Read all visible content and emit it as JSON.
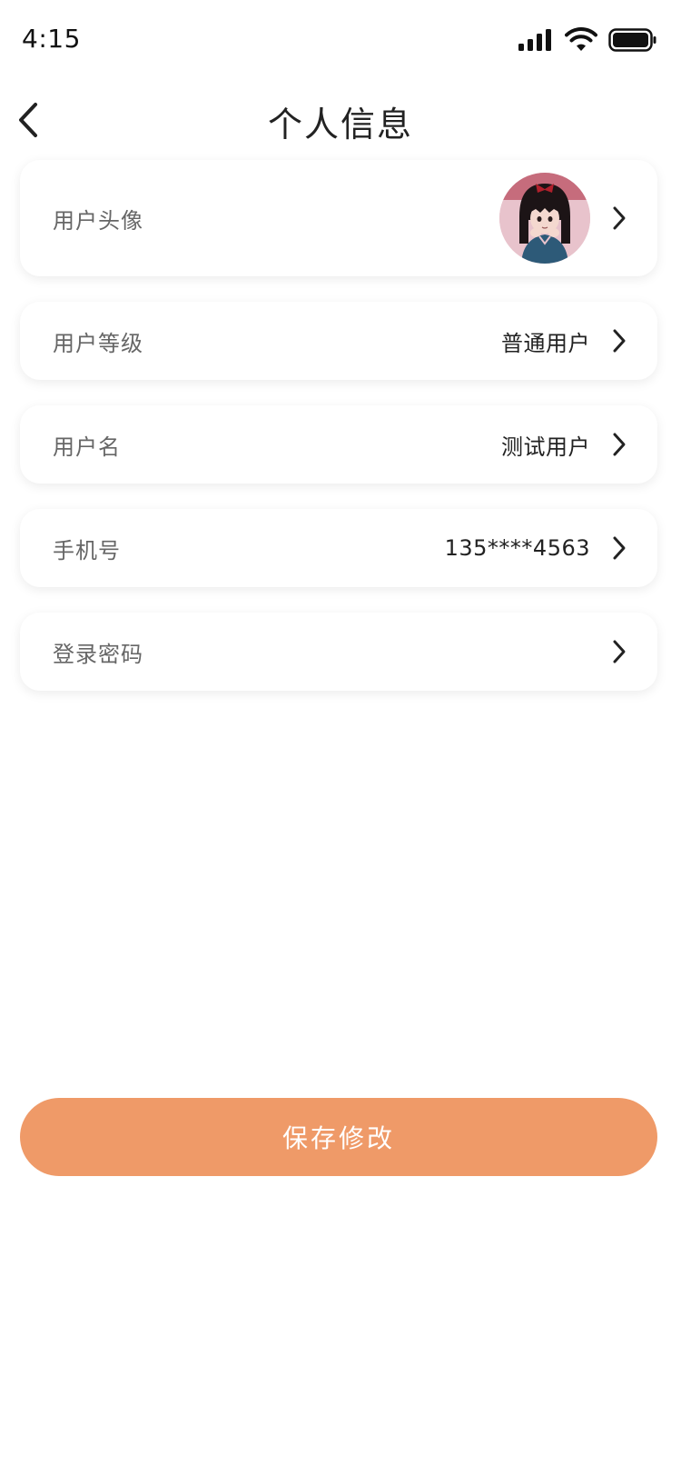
{
  "status_bar": {
    "time": "4:15"
  },
  "nav": {
    "title": "个人信息"
  },
  "rows": {
    "avatar": {
      "label": "用户头像"
    },
    "level": {
      "label": "用户等级",
      "value": "普通用户"
    },
    "username": {
      "label": "用户名",
      "value": "测试用户"
    },
    "phone": {
      "label": "手机号",
      "value": "135****4563"
    },
    "password": {
      "label": "登录密码"
    }
  },
  "save_button": {
    "label": "保存修改"
  },
  "colors": {
    "accent": "#ef9a68",
    "label_text": "#666666",
    "value_text": "#222222"
  },
  "icons": [
    "back-arrow-icon",
    "chevron-right-icon",
    "signal-icon",
    "wifi-icon",
    "battery-icon"
  ]
}
